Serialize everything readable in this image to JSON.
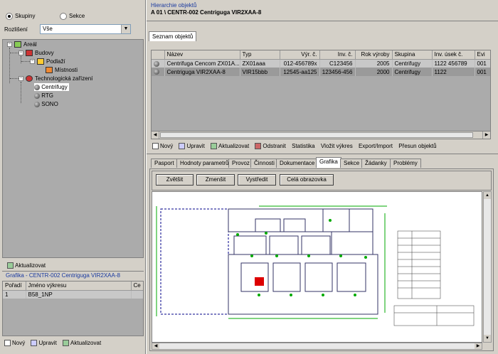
{
  "left": {
    "radio_groups": "Skupiny",
    "radio_sections": "Sekce",
    "resolution_label": "Rozlišení",
    "resolution_value": "Vše",
    "tree": [
      "Areál",
      "Budovy",
      "Podlaží",
      "Místnosti",
      "Technologická zařízení",
      "Centrifugy",
      "RTG",
      "SONO"
    ],
    "refresh": "Aktualizovat",
    "graphics_title": "Grafika - CENTR-002 Centriguga VIR2XAA-8",
    "graphics_cols": [
      "Pořadí",
      "Jméno výkresu",
      "Ce"
    ],
    "graphics_rows": [
      [
        "1",
        "B58_1NP",
        ""
      ]
    ],
    "bottom_toolbar": [
      "Nový",
      "Upravit",
      "Aktualizovat"
    ]
  },
  "header": {
    "hierarchy_label": "Hierarchie objektů",
    "path": "A 01 \\ CENTR-002 Centriguga VIR2XAA-8"
  },
  "main": {
    "list_tab": "Seznam objektů",
    "columns": [
      "Název",
      "Typ",
      "Výr. č.",
      "Inv. č.",
      "Rok výroby",
      "Skupina",
      "Inv. úsek č.",
      "Evi"
    ],
    "rows": [
      [
        "Centrifuga Cencom ZX01A...",
        "ZX01aaa",
        "012-456789x",
        "C123456",
        "2005",
        "Centrifugy",
        "1122 456789",
        "001"
      ],
      [
        "Centriguga VIR2XAA-8",
        "VIR15bbb",
        "12545-aa125",
        "123456-456",
        "2000",
        "Centrifugy",
        "1122",
        "001"
      ]
    ],
    "toolbar": [
      "Nový",
      "Upravit",
      "Aktualizovat",
      "Odstranit",
      "Statistika",
      "Vložit výkres",
      "Export/Import",
      "Přesun objektů"
    ],
    "detail_tabs": [
      "Pasport",
      "Hodnoty parametrů",
      "Provoz",
      "Činnosti",
      "Dokumentace",
      "Grafika",
      "Sekce",
      "Žádanky",
      "Problémy"
    ],
    "active_tab": "Grafika",
    "graphic_buttons": [
      "Zvětšit",
      "Zmenšit",
      "Vystředit",
      "Celá obrazovka"
    ]
  }
}
